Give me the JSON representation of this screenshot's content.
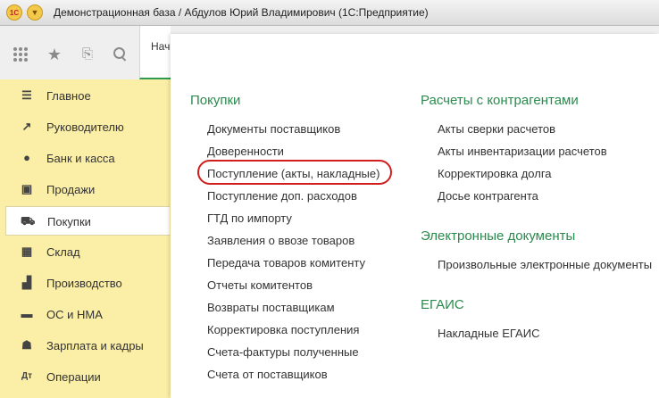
{
  "window": {
    "title": "Демонстрационная база / Абдулов Юрий Владимирович  (1С:Предприятие)",
    "logo_text": "1С"
  },
  "toolbar": {
    "tab_label": "Нач"
  },
  "sidebar": {
    "items": [
      {
        "label": "Главное",
        "icon": "menu-lines-icon"
      },
      {
        "label": "Руководителю",
        "icon": "trend-chart-icon"
      },
      {
        "label": "Банк и касса",
        "icon": "ruble-coin-icon"
      },
      {
        "label": "Продажи",
        "icon": "shopping-bag-icon"
      },
      {
        "label": "Покупки",
        "icon": "cart-icon"
      },
      {
        "label": "Склад",
        "icon": "warehouse-grid-icon"
      },
      {
        "label": "Производство",
        "icon": "factory-icon"
      },
      {
        "label": "ОС и НМА",
        "icon": "truck-icon"
      },
      {
        "label": "Зарплата и кадры",
        "icon": "person-icon"
      },
      {
        "label": "Операции",
        "icon": "operations-icon"
      }
    ],
    "active": "Покупки"
  },
  "panel": {
    "left": {
      "title": "Покупки",
      "links": [
        "Документы поставщиков",
        "Доверенности",
        "Поступление (акты, накладные)",
        "Поступление доп. расходов",
        "ГТД по импорту",
        "Заявления о ввозе товаров",
        "Передача товаров комитенту",
        "Отчеты комитентов",
        "Возвраты поставщикам",
        "Корректировка поступления",
        "Счета-фактуры полученные",
        "Счета от поставщиков"
      ],
      "highlighted_link": "Поступление (акты, накладные)"
    },
    "right": {
      "sections": [
        {
          "title": "Расчеты с контрагентами",
          "links": [
            "Акты сверки расчетов",
            "Акты инвентаризации расчетов",
            "Корректировка долга",
            "Досье контрагента"
          ]
        },
        {
          "title": "Электронные документы",
          "links": [
            "Произвольные электронные документы"
          ]
        },
        {
          "title": "ЕГАИС",
          "links": [
            "Накладные ЕГАИС"
          ]
        }
      ]
    }
  },
  "colors": {
    "sidebar_bg": "#fbeea6",
    "section_title": "#2a8a4e",
    "highlight": "#d01d1d"
  }
}
